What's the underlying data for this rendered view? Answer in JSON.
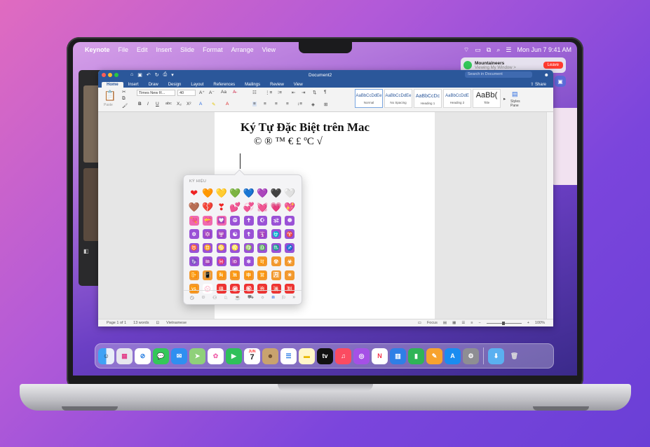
{
  "menubar": {
    "app": "Keynote",
    "items": [
      "File",
      "Edit",
      "Insert",
      "Slide",
      "Format",
      "Arrange",
      "View"
    ],
    "datetime": "Mon Jun 7  9:41 AM"
  },
  "facetime": {
    "name": "Mountaineers",
    "status": "Viewing My Window >",
    "leave": "Leave"
  },
  "word": {
    "doc_name": "Document2",
    "search_placeholder": "Search in Document",
    "tabs": [
      "Home",
      "Insert",
      "Draw",
      "Design",
      "Layout",
      "References",
      "Mailings",
      "Review",
      "View"
    ],
    "share": "Share",
    "paste": "Paste",
    "font_name": "Times New R...",
    "font_size": "40",
    "styles": [
      {
        "preview": "AaBbCcDdEe",
        "name": "Normal"
      },
      {
        "preview": "AaBbCcDdEe",
        "name": "No Spacing"
      },
      {
        "preview": "AaBbCcDc",
        "name": "Heading 1"
      },
      {
        "preview": "AaBbCcDdE",
        "name": "Heading 2"
      },
      {
        "preview": "AaBb(",
        "name": "Title"
      }
    ],
    "styles_pane": "Styles Pane"
  },
  "document": {
    "title": "Ký Tự Đặc Biệt trên Mac",
    "symbols": "© ® ™ € £ ºC √"
  },
  "statusbar": {
    "page": "Page 1 of 1",
    "words": "13 words",
    "language": "Vietnamese",
    "focus": "Focus",
    "zoom": "100%"
  },
  "emoji_picker": {
    "header": "KÝ HIỆU",
    "rows": [
      [
        "❤",
        "🧡",
        "💛",
        "💚",
        "💙",
        "💜",
        "🖤",
        "🤍"
      ],
      [
        "🤎",
        "💔",
        "❣",
        "💕",
        "💞",
        "💓",
        "💗",
        "💖"
      ],
      [
        "💘",
        "💝",
        "💟",
        "☮",
        "✝",
        "☪",
        "🕉",
        "☸"
      ],
      [
        "✡",
        "🔯",
        "🕎",
        "☯",
        "☦",
        "🛐",
        "⛎",
        "♈"
      ],
      [
        "♉",
        "♊",
        "♋",
        "♌",
        "♍",
        "♎",
        "♏",
        "♐"
      ],
      [
        "♑",
        "♒",
        "♓",
        "🆔",
        "⚛",
        "🉑",
        "☢",
        "☣"
      ],
      [
        "📴",
        "📳",
        "🈶",
        "🈚",
        "🈸",
        "🈺",
        "🈷",
        "✴"
      ],
      [
        "🆚",
        "💮",
        "🉐",
        "㊙",
        "㊗",
        "🈴",
        "🈵",
        "🈹"
      ]
    ],
    "categories": [
      "clock",
      "smiley",
      "person",
      "animal",
      "food",
      "car",
      "bulb",
      "symbols",
      "flag",
      "more"
    ]
  },
  "colors": {
    "word_blue": "#2b579a",
    "leave_red": "#ff3b30"
  },
  "dock_apps": [
    "Finder",
    "Launchpad",
    "Safari",
    "Messages",
    "Mail",
    "Maps",
    "Photos",
    "FaceTime",
    "Calendar",
    "Contacts",
    "Reminders",
    "Notes",
    "TV",
    "Music",
    "Podcasts",
    "News",
    "Keynote",
    "Numbers",
    "Pages",
    "App Store",
    "System Preferences",
    "Downloads",
    "Trash"
  ],
  "calendar": {
    "month": "JUN",
    "day": "7"
  }
}
